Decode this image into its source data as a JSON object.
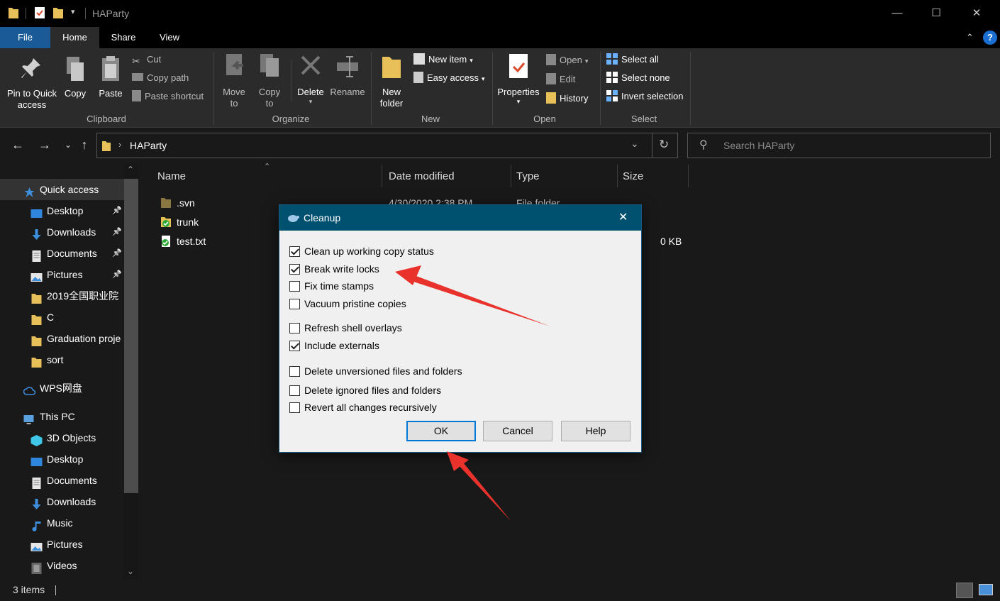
{
  "window": {
    "title": "HAParty",
    "controls": {
      "minimize": "—",
      "maximize": "☐",
      "close": "✕"
    }
  },
  "ribbon_tabs": [
    "File",
    "Home",
    "Share",
    "View"
  ],
  "ribbon": {
    "clipboard": {
      "pin_label": "Pin to Quick access",
      "copy_label": "Copy",
      "paste_label": "Paste",
      "cut_label": "Cut",
      "copy_path_label": "Copy path",
      "paste_shortcut_label": "Paste shortcut",
      "group_label": "Clipboard"
    },
    "organize": {
      "move_to_label": "Move to",
      "copy_to_label": "Copy to",
      "delete_label": "Delete",
      "rename_label": "Rename",
      "group_label": "Organize"
    },
    "new": {
      "new_folder_label": "New folder",
      "new_item_label": "New item",
      "easy_access_label": "Easy access",
      "group_label": "New"
    },
    "open": {
      "properties_label": "Properties",
      "open_label": "Open",
      "edit_label": "Edit",
      "history_label": "History",
      "group_label": "Open"
    },
    "select": {
      "select_all_label": "Select all",
      "select_none_label": "Select none",
      "invert_label": "Invert selection",
      "group_label": "Select"
    }
  },
  "address": {
    "path": "HAParty",
    "search_placeholder": "Search HAParty"
  },
  "sidebar": {
    "items": [
      {
        "label": "Quick access",
        "icon": "star-icon"
      },
      {
        "label": "Desktop",
        "icon": "desktop-icon",
        "pinned": true
      },
      {
        "label": "Downloads",
        "icon": "download-icon",
        "pinned": true
      },
      {
        "label": "Documents",
        "icon": "documents-icon",
        "pinned": true
      },
      {
        "label": "Pictures",
        "icon": "pictures-icon",
        "pinned": true
      },
      {
        "label": "2019全国职业院",
        "icon": "folder-icon"
      },
      {
        "label": "C",
        "icon": "folder-icon"
      },
      {
        "label": "Graduation proje",
        "icon": "folder-icon"
      },
      {
        "label": "sort",
        "icon": "folder-icon"
      },
      {
        "label": "WPS网盘",
        "icon": "cloud-icon"
      },
      {
        "label": "This PC",
        "icon": "computer-icon"
      },
      {
        "label": "3D Objects",
        "icon": "cube-icon"
      },
      {
        "label": "Desktop",
        "icon": "desktop-icon"
      },
      {
        "label": "Documents",
        "icon": "documents-icon"
      },
      {
        "label": "Downloads",
        "icon": "download-icon"
      },
      {
        "label": "Music",
        "icon": "music-icon"
      },
      {
        "label": "Pictures",
        "icon": "pictures-icon"
      },
      {
        "label": "Videos",
        "icon": "videos-icon"
      }
    ]
  },
  "file_list": {
    "columns": [
      "Name",
      "Date modified",
      "Type",
      "Size"
    ],
    "rows": [
      {
        "name": ".svn",
        "date": "4/30/2020 2:38 PM",
        "type": "File folder",
        "size": ""
      },
      {
        "name": "trunk",
        "date": "",
        "type": "",
        "size": ""
      },
      {
        "name": "test.txt",
        "date": "",
        "type": "",
        "size": "0 KB"
      }
    ]
  },
  "status": {
    "items_count": "3 items"
  },
  "dialog": {
    "title": "Cleanup",
    "options": [
      {
        "label": "Clean up working copy status",
        "checked": true
      },
      {
        "label": "Break write locks",
        "checked": true
      },
      {
        "label": "Fix time stamps",
        "checked": false
      },
      {
        "label": "Vacuum pristine copies",
        "checked": false
      },
      {
        "label": "Refresh shell overlays",
        "checked": false
      },
      {
        "label": "Include externals",
        "checked": true
      },
      {
        "label": "Delete unversioned files and folders",
        "checked": false
      },
      {
        "label": "Delete ignored files and folders",
        "checked": false
      },
      {
        "label": "Revert all changes recursively",
        "checked": false
      }
    ],
    "ok_label": "OK",
    "cancel_label": "Cancel",
    "help_label": "Help"
  },
  "colors": {
    "accent": "#1a5a96",
    "dialog_title_bar": "#00516f",
    "annotation_arrow": "#e8322b",
    "folder": "#e8c05a"
  }
}
